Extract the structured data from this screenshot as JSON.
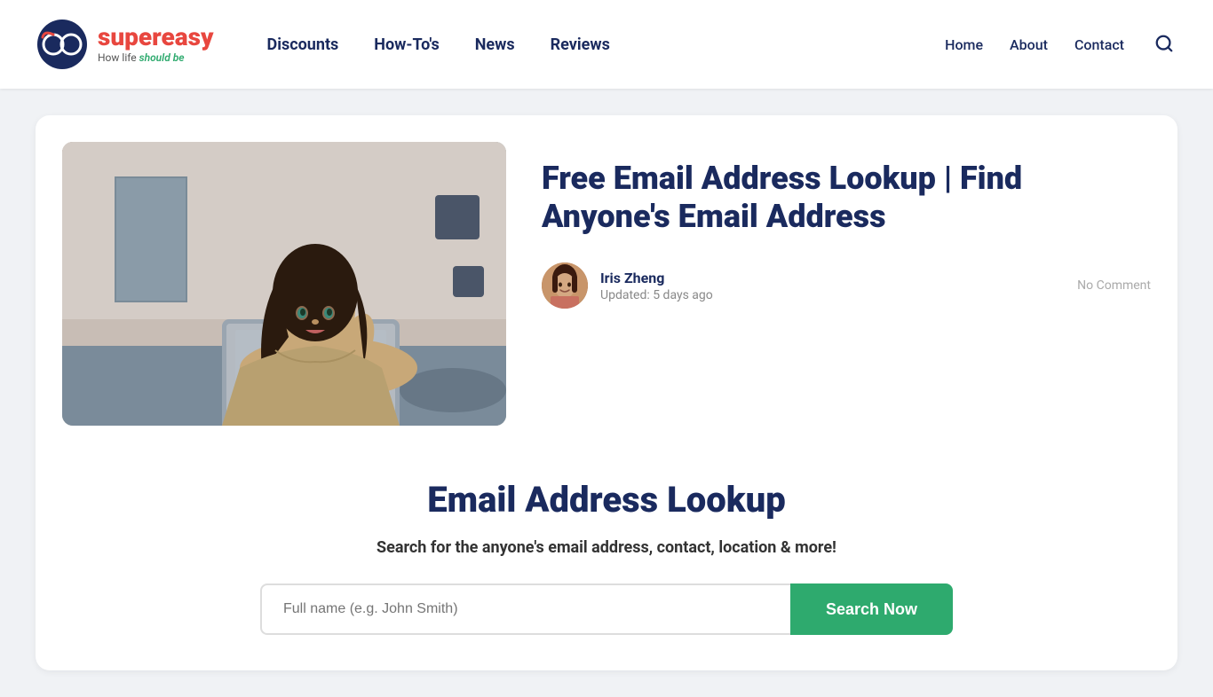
{
  "header": {
    "logo": {
      "brand_part1": "super",
      "brand_part2": "easy",
      "tagline_prefix": "How life ",
      "tagline_highlight": "should be"
    },
    "nav_main": [
      {
        "label": "Discounts",
        "href": "#"
      },
      {
        "label": "How-To's",
        "href": "#"
      },
      {
        "label": "News",
        "href": "#"
      },
      {
        "label": "Reviews",
        "href": "#"
      }
    ],
    "nav_right": [
      {
        "label": "Home",
        "href": "#"
      },
      {
        "label": "About",
        "href": "#"
      },
      {
        "label": "Contact",
        "href": "#"
      }
    ]
  },
  "article": {
    "title": "Free Email Address Lookup | Find Anyone's Email Address",
    "author_name": "Iris Zheng",
    "updated": "Updated: 5 days ago",
    "no_comment": "No Comment"
  },
  "lookup": {
    "title": "Email Address Lookup",
    "description": "Search for the anyone's email address, contact, location & more!",
    "input_placeholder": "Full name (e.g. John Smith)",
    "button_label": "Search Now"
  },
  "colors": {
    "brand_dark": "#1a2a5e",
    "brand_red": "#e8473f",
    "brand_green": "#2eaa6e"
  }
}
